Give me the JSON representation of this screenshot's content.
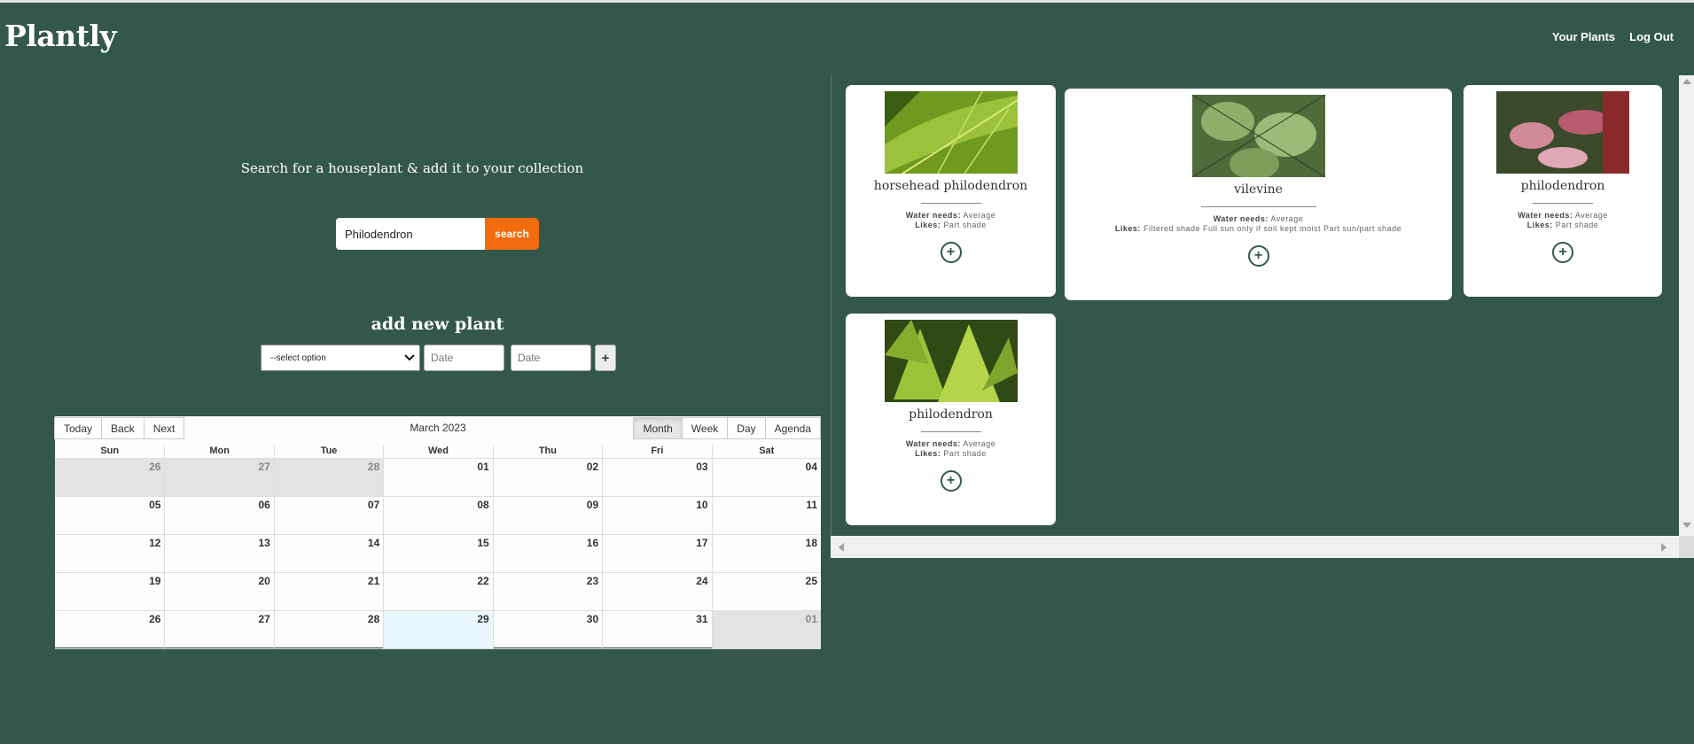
{
  "app": {
    "title": "Plantly"
  },
  "nav": {
    "your_plants": "Your Plants",
    "log_out": "Log Out"
  },
  "search": {
    "heading": "Search for a houseplant & add it to your collection",
    "value": "Philodendron",
    "button": "search"
  },
  "add_plant": {
    "heading": "add new plant",
    "select_value": "--select option",
    "date_placeholder_1": "Date",
    "date_placeholder_2": "Date",
    "add_button": "+"
  },
  "calendar": {
    "nav_buttons": [
      "Today",
      "Back",
      "Next"
    ],
    "label": "March 2023",
    "view_buttons": [
      "Month",
      "Week",
      "Day",
      "Agenda"
    ],
    "active_view": "Month",
    "weekdays": [
      "Sun",
      "Mon",
      "Tue",
      "Wed",
      "Thu",
      "Fri",
      "Sat"
    ],
    "days": [
      {
        "n": "26",
        "off": true
      },
      {
        "n": "27",
        "off": true
      },
      {
        "n": "28",
        "off": true
      },
      {
        "n": "01"
      },
      {
        "n": "02"
      },
      {
        "n": "03"
      },
      {
        "n": "04"
      },
      {
        "n": "05"
      },
      {
        "n": "06"
      },
      {
        "n": "07"
      },
      {
        "n": "08"
      },
      {
        "n": "09"
      },
      {
        "n": "10"
      },
      {
        "n": "11"
      },
      {
        "n": "12"
      },
      {
        "n": "13"
      },
      {
        "n": "14"
      },
      {
        "n": "15"
      },
      {
        "n": "16"
      },
      {
        "n": "17"
      },
      {
        "n": "18"
      },
      {
        "n": "19"
      },
      {
        "n": "20"
      },
      {
        "n": "21"
      },
      {
        "n": "22"
      },
      {
        "n": "23"
      },
      {
        "n": "24"
      },
      {
        "n": "25"
      },
      {
        "n": "26"
      },
      {
        "n": "27"
      },
      {
        "n": "28"
      },
      {
        "n": "29",
        "today": true
      },
      {
        "n": "30"
      },
      {
        "n": "31"
      },
      {
        "n": "01",
        "off": true
      }
    ]
  },
  "plants": [
    {
      "name": "horsehead philodendron",
      "water_label": "Water needs:",
      "water": "Average",
      "likes_label": "Likes:",
      "likes": "Part shade",
      "add_icon": "plus-circle-icon"
    },
    {
      "name": "vilevine",
      "water_label": "Water needs:",
      "water": "Average",
      "likes_label": "Likes:",
      "likes": "Filtered shade Full sun only if soil kept moist Part sun/part shade",
      "add_icon": "plus-circle-icon"
    },
    {
      "name": "philodendron",
      "water_label": "Water needs:",
      "water": "Average",
      "likes_label": "Likes:",
      "likes": "Part shade",
      "add_icon": "plus-circle-icon"
    },
    {
      "name": "philodendron",
      "water_label": "Water needs:",
      "water": "Average",
      "likes_label": "Likes:",
      "likes": "Part shade",
      "add_icon": "plus-circle-icon"
    }
  ],
  "colors": {
    "background": "#34574b",
    "accent": "#f26b0f",
    "today": "#eaf6ff"
  }
}
